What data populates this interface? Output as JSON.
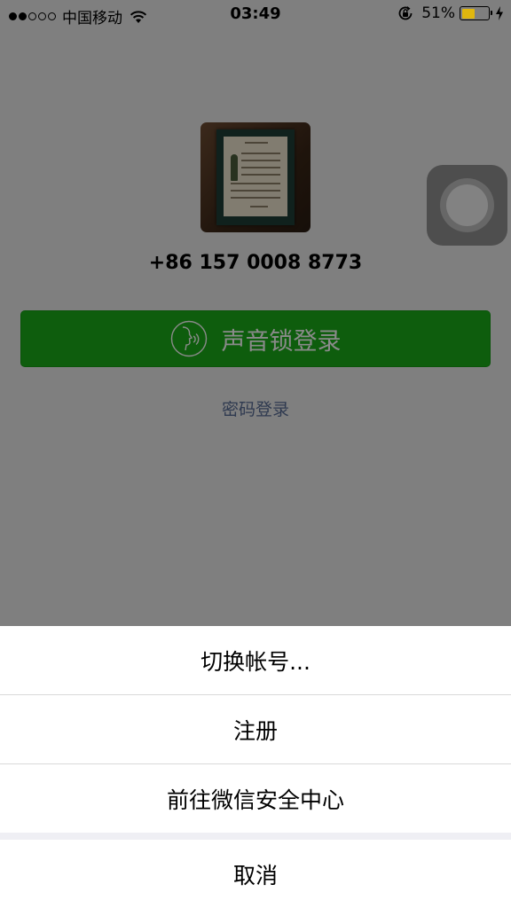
{
  "status_bar": {
    "signal_dots_filled": 2,
    "signal_dots_total": 5,
    "carrier": "中国移动",
    "time": "03:49",
    "battery_percent": "51%",
    "battery_level": 0.51,
    "battery_color": "#e0b70e",
    "icons": [
      "wifi-icon",
      "rotation-lock-icon",
      "battery-icon",
      "charging-bolt-icon"
    ]
  },
  "login": {
    "phone_number": "+86 157 0008 8773",
    "voice_login_label": "声音锁登录",
    "voice_icon": "voice-profile-icon",
    "password_login_label": "密码登录",
    "accent_color": "#1aad19",
    "link_color": "#576b95"
  },
  "action_sheet": {
    "items": [
      {
        "label": "切换帐号..."
      },
      {
        "label": "注册"
      },
      {
        "label": "前往微信安全中心"
      }
    ],
    "cancel_label": "取消"
  }
}
